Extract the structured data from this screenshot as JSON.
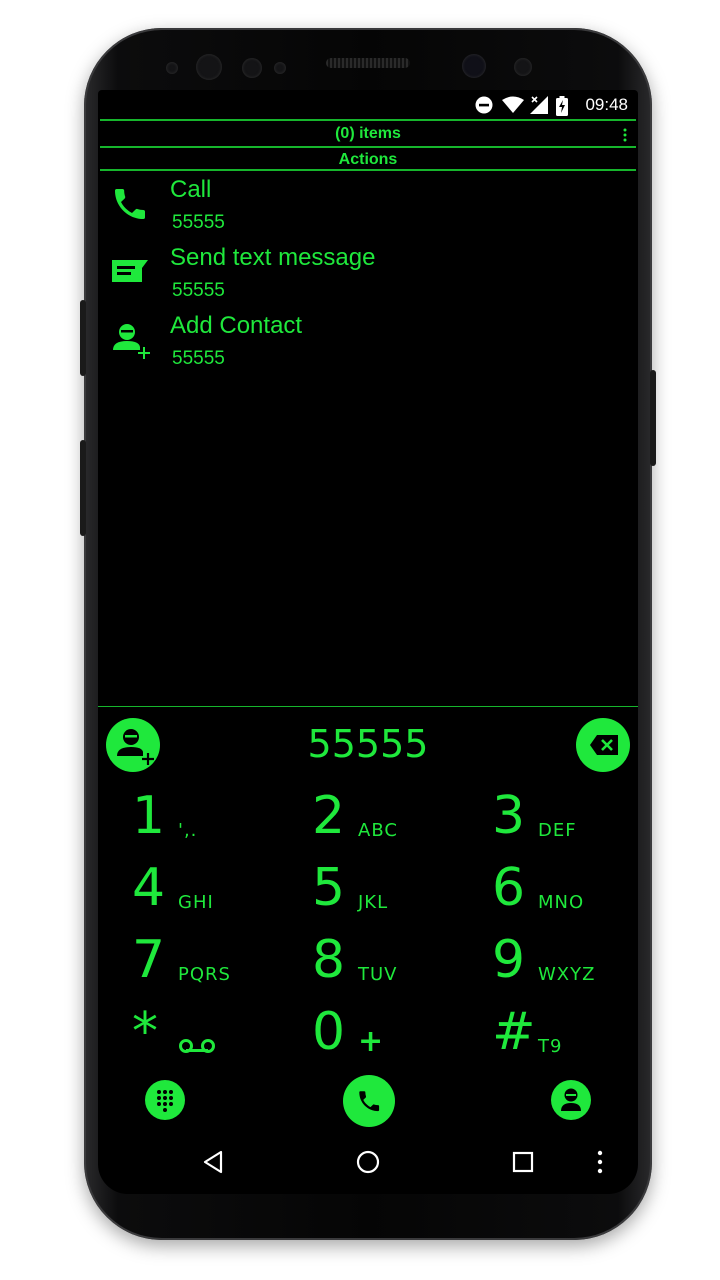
{
  "status_bar": {
    "time": "09:48"
  },
  "header": {
    "items_label": "(0) items",
    "section_label": "Actions"
  },
  "actions": [
    {
      "title": "Call",
      "number": "55555",
      "icon": "phone-icon"
    },
    {
      "title": "Send text message",
      "number": "55555",
      "icon": "message-icon"
    },
    {
      "title": "Add Contact",
      "number": "55555",
      "icon": "add-contact-icon"
    }
  ],
  "dialer": {
    "input_value": "55555",
    "keys": [
      {
        "digit": "1",
        "letters": "',."
      },
      {
        "digit": "2",
        "letters": "ABC"
      },
      {
        "digit": "3",
        "letters": "DEF"
      },
      {
        "digit": "4",
        "letters": "GHI"
      },
      {
        "digit": "5",
        "letters": "JKL"
      },
      {
        "digit": "6",
        "letters": "MNO"
      },
      {
        "digit": "7",
        "letters": "PQRS"
      },
      {
        "digit": "8",
        "letters": "TUV"
      },
      {
        "digit": "9",
        "letters": "WXYZ"
      },
      {
        "digit": "*",
        "letters": ""
      },
      {
        "digit": "0",
        "letters": "+"
      },
      {
        "digit": "#",
        "letters": "T9"
      }
    ]
  },
  "colors": {
    "accent": "#1fe83c",
    "background": "#000000"
  }
}
